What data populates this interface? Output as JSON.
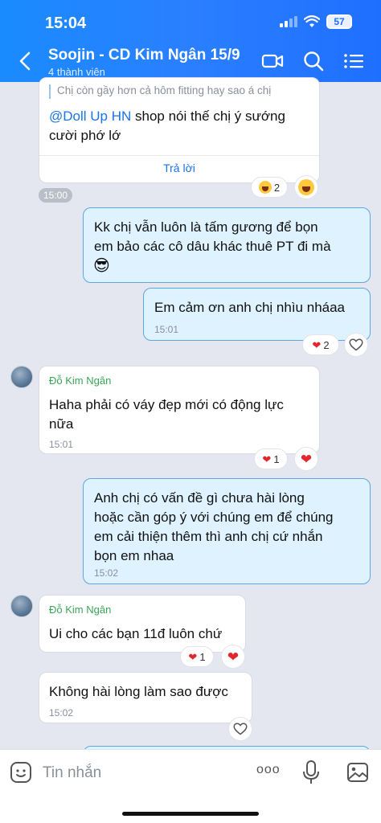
{
  "status": {
    "time": "15:04",
    "battery": "57"
  },
  "header": {
    "title": "Soojin - CD Kim Ngân 15/9",
    "subtitle": "4 thành viên",
    "icons": [
      "back-icon",
      "video-call-icon",
      "search-icon",
      "menu-icon"
    ]
  },
  "messages": {
    "m1": {
      "quote": "Chị còn gầy hơn cả hôm fitting hay sao á chị",
      "mention": "@Doll Up HN",
      "text_line1": " shop nói thế chị ý sướng",
      "text_line2": "cười phớ lớ",
      "reply_label": "Trả lời",
      "time": "15:00",
      "reaction_count": "2"
    },
    "m2": {
      "text_line1": "Kk chị vẫn luôn là tấm gương để bọn",
      "text_line2": "em bảo các cô dâu khác thuê PT đi mà",
      "emoji": "😎"
    },
    "m3": {
      "text": "Em cảm ơn anh chị nhìu nháaa",
      "time": "15:01",
      "reaction_count": "2"
    },
    "m4": {
      "sender": "Đỗ Kim Ngân",
      "text_line1": "Haha phải có váy đẹp mới có động lực",
      "text_line2": "nữa",
      "time": "15:01",
      "reaction_count": "1"
    },
    "m5": {
      "text_line1": "Anh chị có vấn đề gì chưa hài lòng",
      "text_line2": "hoặc cần góp ý với chúng em để chúng",
      "text_line3": "em cải thiện thêm thì anh chị cứ nhắn",
      "text_line4": "bọn em nhaa",
      "time": "15:02"
    },
    "m6": {
      "sender": "Đỗ Kim Ngân",
      "text": "Ui cho các bạn 11đ luôn chứ",
      "reaction_count": "1"
    },
    "m7": {
      "text": "Không hài lòng làm sao được",
      "time": "15:02"
    }
  },
  "composer": {
    "placeholder": "Tin nhắn",
    "more_label": "ooo"
  }
}
